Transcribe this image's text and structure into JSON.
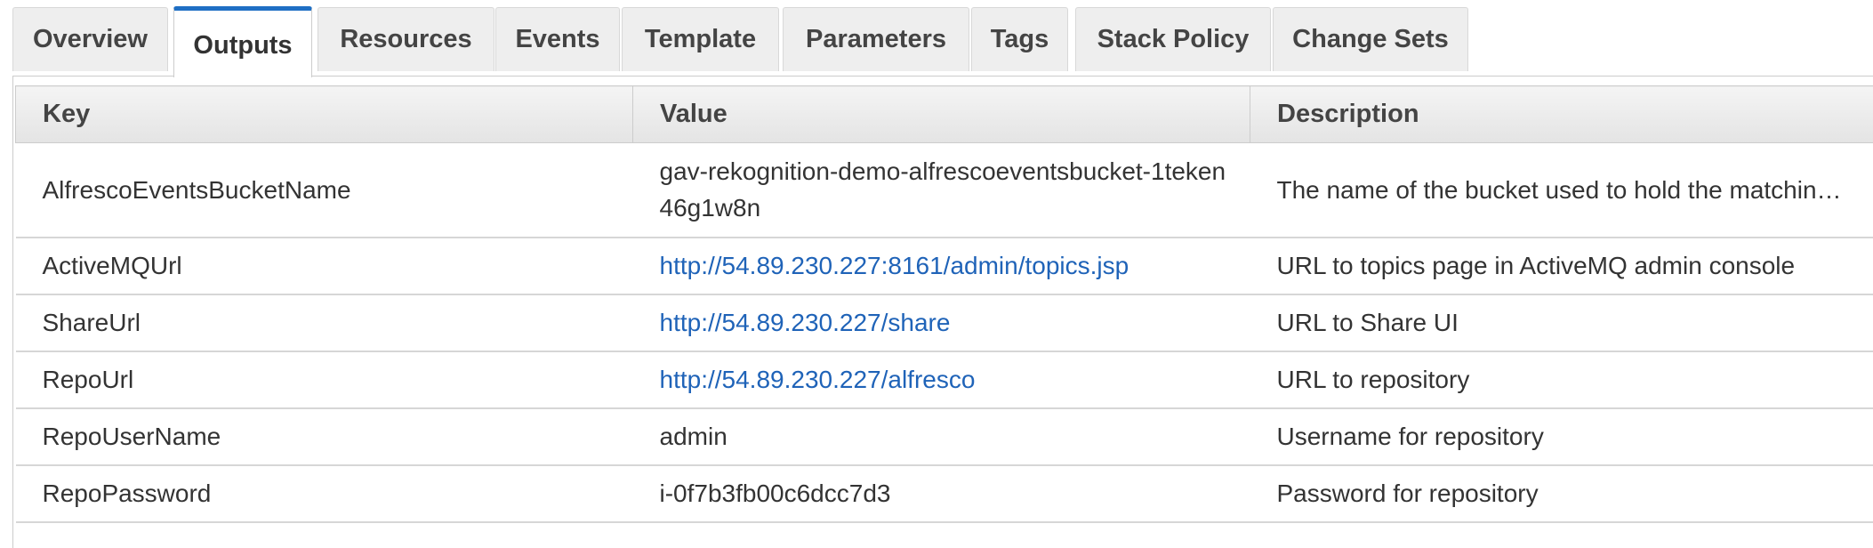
{
  "tabs": [
    {
      "label": "Overview",
      "active": false
    },
    {
      "label": "Outputs",
      "active": true
    },
    {
      "label": "Resources",
      "active": false
    },
    {
      "label": "Events",
      "active": false
    },
    {
      "label": "Template",
      "active": false
    },
    {
      "label": "Parameters",
      "active": false
    },
    {
      "label": "Tags",
      "active": false
    },
    {
      "label": "Stack Policy",
      "active": false
    },
    {
      "label": "Change Sets",
      "active": false
    }
  ],
  "table": {
    "headers": {
      "key": "Key",
      "value": "Value",
      "description": "Description"
    },
    "rows": [
      {
        "key": "AlfrescoEventsBucketName",
        "value": "gav-rekognition-demo-alfrescoeventsbucket-1teken46g1w8n",
        "description": "The name of the bucket used to hold the matchin…"
      },
      {
        "key": "ActiveMQUrl",
        "value": "http://54.89.230.227:8161/admin/topics.jsp",
        "description": "URL to topics page in ActiveMQ admin console"
      },
      {
        "key": "ShareUrl",
        "value": "http://54.89.230.227/share",
        "description": "URL to Share UI"
      },
      {
        "key": "RepoUrl",
        "value": "http://54.89.230.227/alfresco",
        "description": "URL to repository"
      },
      {
        "key": "RepoUserName",
        "value": "admin",
        "description": "Username for repository"
      },
      {
        "key": "RepoPassword",
        "value": "i-0f7b3fb00c6dcc7d3",
        "description": "Password for repository"
      }
    ]
  },
  "colors": {
    "accent": "#1f6fc4",
    "link": "#1f63b8",
    "header_bg": "#e9e9e9",
    "border": "#cccccc"
  }
}
